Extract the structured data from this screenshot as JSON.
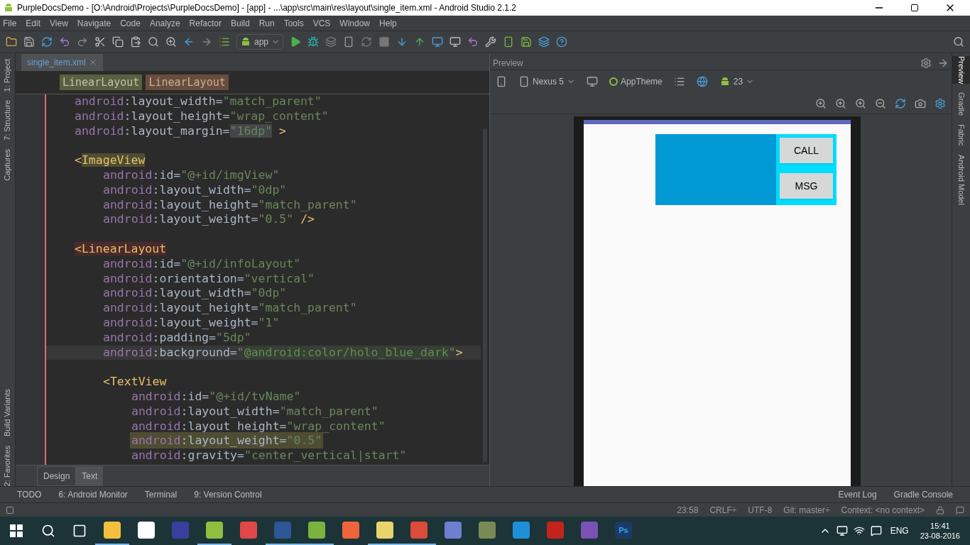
{
  "window": {
    "title": "PurpleDocsDemo - [O:\\Android\\Projects\\PurpleDocsDemo] - [app] - ...\\app\\src\\main\\res\\layout\\single_item.xml - Android Studio 2.1.2"
  },
  "menu": [
    "File",
    "Edit",
    "View",
    "Navigate",
    "Code",
    "Analyze",
    "Refactor",
    "Build",
    "Run",
    "Tools",
    "VCS",
    "Window",
    "Help"
  ],
  "toolbar": {
    "run_config": "app"
  },
  "left_strip": [
    "1: Project",
    "7: Structure",
    "Captures",
    "Build Variants",
    "2: Favorites"
  ],
  "right_strip": [
    {
      "label": "Preview",
      "selected": true
    },
    {
      "label": "Gradle",
      "selected": false
    },
    {
      "label": "Fabric",
      "selected": false
    },
    {
      "label": "Android Model",
      "selected": false
    }
  ],
  "editor": {
    "file_tab": "single_item.xml",
    "breadcrumbs": [
      {
        "label": "LinearLayout",
        "selected": false
      },
      {
        "label": "LinearLayout",
        "selected": true
      }
    ],
    "code": {
      "attributes": [
        {
          "current": false,
          "warning": false,
          "segments": [
            {
              "kind": "ns",
              "text": "android"
            },
            {
              "kind": "plain",
              "text": ":layout_width="
            },
            {
              "kind": "str",
              "text": "\"match_parent\""
            }
          ]
        },
        {
          "current": false,
          "warning": false,
          "segments": [
            {
              "kind": "ns",
              "text": "android"
            },
            {
              "kind": "plain",
              "text": ":layout_height="
            },
            {
              "kind": "str",
              "text": "\"wrap_content\""
            }
          ]
        },
        {
          "current": false,
          "warning": false,
          "segments": [
            {
              "kind": "ns",
              "text": "android"
            },
            {
              "kind": "plain",
              "text": ":layout_margin="
            },
            {
              "kind": "str_usage",
              "text": "\"16dp\""
            },
            {
              "kind": "tag",
              "text": " >"
            }
          ]
        }
      ],
      "children": [
        {
          "tag": {
            "current": false,
            "warning": false,
            "segments": [
              {
                "kind": "tag",
                "text": "<"
              },
              {
                "kind": "tag_match",
                "text": "ImageView"
              }
            ]
          },
          "attributes": [
            {
              "current": false,
              "warning": false,
              "segments": [
                {
                  "kind": "ns",
                  "text": "android"
                },
                {
                  "kind": "plain",
                  "text": ":id="
                },
                {
                  "kind": "str",
                  "text": "\"@+id/imgView\""
                }
              ]
            },
            {
              "current": false,
              "warning": false,
              "segments": [
                {
                  "kind": "ns",
                  "text": "android"
                },
                {
                  "kind": "plain",
                  "text": ":layout_width="
                },
                {
                  "kind": "str",
                  "text": "\"0dp\""
                }
              ]
            },
            {
              "current": false,
              "warning": false,
              "segments": [
                {
                  "kind": "ns",
                  "text": "android"
                },
                {
                  "kind": "plain",
                  "text": ":layout_height="
                },
                {
                  "kind": "str",
                  "text": "\"match_parent\""
                }
              ]
            },
            {
              "current": false,
              "warning": false,
              "segments": [
                {
                  "kind": "ns",
                  "text": "android"
                },
                {
                  "kind": "plain",
                  "text": ":layout_weight="
                },
                {
                  "kind": "str",
                  "text": "\"0.5\""
                },
                {
                  "kind": "tag",
                  "text": " />"
                }
              ]
            }
          ]
        },
        {
          "tag": {
            "current": false,
            "warning": false,
            "segments": [
              {
                "kind": "tag_error",
                "text": "<LinearLayout"
              }
            ]
          },
          "attributes": [
            {
              "current": false,
              "warning": false,
              "segments": [
                {
                  "kind": "ns",
                  "text": "android"
                },
                {
                  "kind": "plain",
                  "text": ":id="
                },
                {
                  "kind": "str",
                  "text": "\"@+id/infoLayout\""
                }
              ]
            },
            {
              "current": false,
              "warning": false,
              "segments": [
                {
                  "kind": "ns",
                  "text": "android"
                },
                {
                  "kind": "plain",
                  "text": ":orientation="
                },
                {
                  "kind": "str",
                  "text": "\"vertical\""
                }
              ]
            },
            {
              "current": false,
              "warning": false,
              "segments": [
                {
                  "kind": "ns",
                  "text": "android"
                },
                {
                  "kind": "plain",
                  "text": ":layout_width="
                },
                {
                  "kind": "str",
                  "text": "\"0dp\""
                }
              ]
            },
            {
              "current": false,
              "warning": false,
              "segments": [
                {
                  "kind": "ns",
                  "text": "android"
                },
                {
                  "kind": "plain",
                  "text": ":layout_height="
                },
                {
                  "kind": "str",
                  "text": "\"match_parent\""
                }
              ]
            },
            {
              "current": false,
              "warning": false,
              "segments": [
                {
                  "kind": "ns",
                  "text": "android"
                },
                {
                  "kind": "plain",
                  "text": ":layout_weight="
                },
                {
                  "kind": "str",
                  "text": "\"1\""
                }
              ]
            },
            {
              "current": false,
              "warning": false,
              "segments": [
                {
                  "kind": "ns",
                  "text": "android"
                },
                {
                  "kind": "plain",
                  "text": ":padding="
                },
                {
                  "kind": "str",
                  "text": "\"5dp\""
                }
              ]
            },
            {
              "current": true,
              "warning": false,
              "segments": [
                {
                  "kind": "ns",
                  "text": "android"
                },
                {
                  "kind": "plain",
                  "text": ":background="
                },
                {
                  "kind": "str",
                  "text": "\""
                },
                {
                  "kind": "str_resource",
                  "text": "@android:color/holo_blue_dark"
                },
                {
                  "kind": "str",
                  "text": "\""
                },
                {
                  "kind": "tag",
                  "text": ">"
                }
              ]
            }
          ],
          "children": [
            {
              "tag": {
                "current": false,
                "warning": false,
                "segments": [
                  {
                    "kind": "tag",
                    "text": "<TextView"
                  }
                ]
              },
              "attributes": [
                {
                  "current": false,
                  "warning": false,
                  "segments": [
                    {
                      "kind": "ns",
                      "text": "android"
                    },
                    {
                      "kind": "plain",
                      "text": ":id="
                    },
                    {
                      "kind": "str",
                      "text": "\"@+id/tvName\""
                    }
                  ]
                },
                {
                  "current": false,
                  "warning": false,
                  "segments": [
                    {
                      "kind": "ns",
                      "text": "android"
                    },
                    {
                      "kind": "plain",
                      "text": ":layout_width="
                    },
                    {
                      "kind": "str",
                      "text": "\"match_parent\""
                    }
                  ]
                },
                {
                  "current": false,
                  "warning": false,
                  "segments": [
                    {
                      "kind": "ns",
                      "text": "android"
                    },
                    {
                      "kind": "plain",
                      "text": ":layout_height="
                    },
                    {
                      "kind": "str",
                      "text": "\"wrap_content\""
                    }
                  ]
                },
                {
                  "current": false,
                  "warning": true,
                  "segments": [
                    {
                      "kind": "ns",
                      "text": "android"
                    },
                    {
                      "kind": "plain",
                      "text": ":layout_weight="
                    },
                    {
                      "kind": "str",
                      "text": "\"0.5\""
                    }
                  ]
                },
                {
                  "current": false,
                  "warning": false,
                  "segments": [
                    {
                      "kind": "ns",
                      "text": "android"
                    },
                    {
                      "kind": "plain",
                      "text": ":gravity="
                    },
                    {
                      "kind": "str",
                      "text": "\"center_vertical|start\""
                    }
                  ]
                }
              ]
            }
          ]
        }
      ]
    },
    "view_tabs": [
      {
        "label": "Design",
        "selected": false
      },
      {
        "label": "Text",
        "selected": true
      }
    ]
  },
  "preview": {
    "title": "Preview",
    "device": "Nexus 5",
    "theme": "AppTheme",
    "api": "23",
    "buttons": [
      "CALL",
      "MSG"
    ]
  },
  "tool_windows": {
    "left": [
      "TODO",
      "6: Android Monitor",
      "Terminal",
      "9: Version Control"
    ],
    "right": [
      "Event Log",
      "Gradle Console"
    ]
  },
  "status_bar": {
    "position": "23:58",
    "line_separator": "CRLF÷",
    "encoding": "UTF-8",
    "vcs": "Git: master÷",
    "context": "Context: <no context>"
  },
  "taskbar": {
    "apps": [
      {
        "color": "#f3c03e",
        "running": true
      },
      {
        "color": "#ffffff",
        "running": false
      },
      {
        "color": "#3a3f9e",
        "running": false
      },
      {
        "color": "#8fbf3f",
        "running": true
      },
      {
        "color": "#e04848",
        "running": false
      },
      {
        "color": "#2b5797",
        "running": true
      },
      {
        "color": "#7bb33e",
        "running": true
      },
      {
        "color": "#f0643c",
        "running": false
      },
      {
        "color": "#e8d46a",
        "running": true
      },
      {
        "color": "#dd4b39",
        "running": true
      },
      {
        "color": "#6c7fd0",
        "running": false
      },
      {
        "color": "#7a8a55",
        "running": false
      },
      {
        "color": "#1e8fd8",
        "running": false
      },
      {
        "color": "#c4231c",
        "running": false
      },
      {
        "color": "#7a52b3",
        "running": false
      },
      {
        "color": "#1d3a66",
        "running": false,
        "label": "Ps"
      }
    ],
    "language": "ENG",
    "time": "15:41",
    "date": "23-08-2016"
  }
}
